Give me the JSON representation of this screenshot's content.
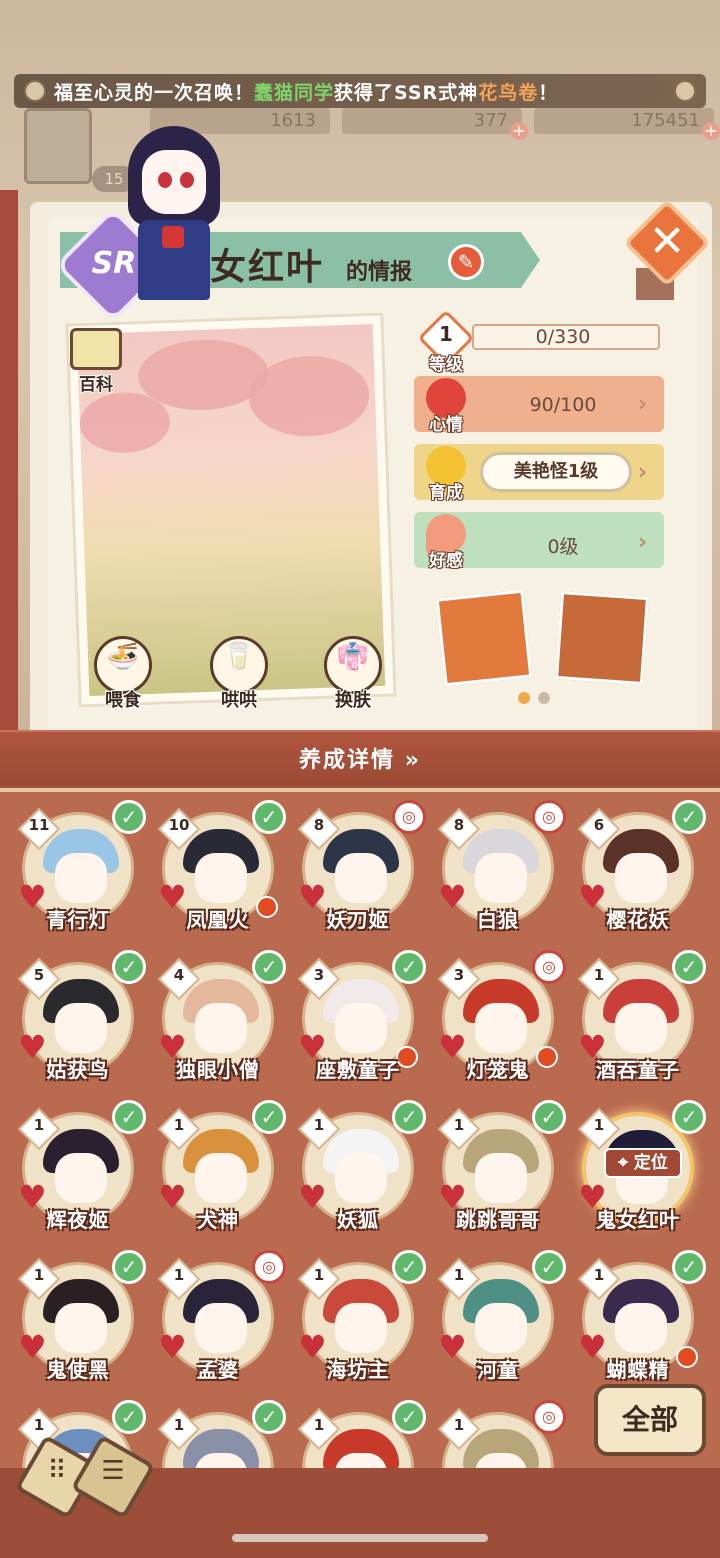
{
  "ticker": {
    "prefix": "福至心灵的一次召唤！",
    "player": "蠢猫同学",
    "middle": "获得了SSR式神",
    "shikigami": "花鸟卷",
    "suffix": "！"
  },
  "resources": {
    "level": "15",
    "r1": "1613",
    "r2": "377",
    "r3": "175451"
  },
  "info": {
    "rarity": "SR",
    "name": "鬼女红叶",
    "title_suffix": "的情报",
    "baike_label": "百科"
  },
  "actions": {
    "feed": "喂食",
    "coax": "哄哄",
    "skin": "换肤"
  },
  "stats": {
    "level_num": "1",
    "level_label": "等级",
    "exp": "0/330",
    "mood_label": "心情",
    "mood": "90/100",
    "grow_label": "育成",
    "grow": "美艳怪1级",
    "affection_label": "好感",
    "affection": "0级"
  },
  "section": {
    "title": "养成详情"
  },
  "controls": {
    "all": "全部",
    "locate": "定位"
  },
  "colors": {
    "accent": "#e9743d",
    "check": "#5fb86b",
    "panel": "#b96a4f"
  },
  "shikigami": [
    {
      "level": "11",
      "name": "青行灯",
      "status": "check",
      "hair": "#9ac6e6"
    },
    {
      "level": "10",
      "name": "凤凰火",
      "status": "check",
      "hair": "#2a2a36",
      "red": true
    },
    {
      "level": "8",
      "name": "妖刀姬",
      "status": "bell",
      "hair": "#2c3648"
    },
    {
      "level": "8",
      "name": "白狼",
      "status": "bell",
      "hair": "#d9d6dc"
    },
    {
      "level": "6",
      "name": "樱花妖",
      "status": "check",
      "hair": "#5a3228"
    },
    {
      "level": "5",
      "name": "姑获鸟",
      "status": "check",
      "hair": "#2a2a2e"
    },
    {
      "level": "4",
      "name": "独眼小僧",
      "status": "check",
      "hair": "#e3b89c"
    },
    {
      "level": "3",
      "name": "座敷童子",
      "status": "check",
      "hair": "#f2e9ea",
      "red": true
    },
    {
      "level": "3",
      "name": "灯笼鬼",
      "status": "bell",
      "hair": "#c73a2a",
      "red": true
    },
    {
      "level": "1",
      "name": "酒吞童子",
      "status": "check",
      "hair": "#c9403a"
    },
    {
      "level": "1",
      "name": "辉夜姬",
      "status": "check",
      "hair": "#2a2030"
    },
    {
      "level": "1",
      "name": "犬神",
      "status": "check",
      "hair": "#d9913e"
    },
    {
      "level": "1",
      "name": "妖狐",
      "status": "check",
      "hair": "#f4f4f4"
    },
    {
      "level": "1",
      "name": "跳跳哥哥",
      "status": "check",
      "hair": "#b9a57a"
    },
    {
      "level": "1",
      "name": "鬼女红叶",
      "status": "check",
      "hair": "#1f1c3a",
      "selected": true
    },
    {
      "level": "1",
      "name": "鬼使黑",
      "status": "check",
      "hair": "#2a2024"
    },
    {
      "level": "1",
      "name": "孟婆",
      "status": "bell",
      "hair": "#2a2438"
    },
    {
      "level": "1",
      "name": "海坊主",
      "status": "check",
      "hair": "#c9493a"
    },
    {
      "level": "1",
      "name": "河童",
      "status": "check",
      "hair": "#4f8f86"
    },
    {
      "level": "1",
      "name": "蝴蝶精",
      "status": "check",
      "hair": "#3a2a4e",
      "red": true
    },
    {
      "level": "1",
      "name": "",
      "status": "check",
      "hair": "#6b8fbf"
    },
    {
      "level": "1",
      "name": "",
      "status": "check",
      "hair": "#8a90a8"
    },
    {
      "level": "1",
      "name": "",
      "status": "check",
      "hair": "#c73a2a"
    },
    {
      "level": "1",
      "name": "",
      "status": "bell",
      "hair": "#b9a57a"
    }
  ]
}
